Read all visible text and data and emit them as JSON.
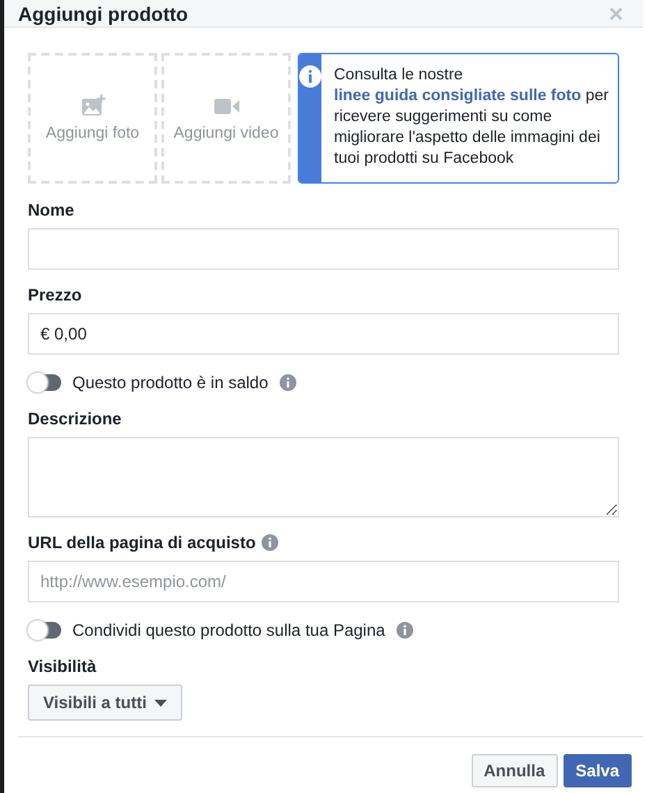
{
  "dialog": {
    "title": "Aggiungi prodotto",
    "close": "×"
  },
  "media": [
    {
      "kind": "photo",
      "label": "Aggiungi foto"
    },
    {
      "kind": "video",
      "label": "Aggiungi video"
    }
  ],
  "notice": {
    "before": "Consulta le nostre ",
    "link": "linee guida consigliate sulle foto",
    "after": " per ricevere suggerimenti su come migliorare l'aspetto delle immagini dei tuoi prodotti su Facebook"
  },
  "fields": [
    {
      "kind": "text",
      "label": "Nome",
      "info": false
    },
    {
      "kind": "text",
      "label": "Prezzo",
      "info": false,
      "value": "€ 0,00"
    },
    {
      "kind": "toggle",
      "label": "Questo prodotto è in saldo",
      "info": true,
      "on": false
    },
    {
      "kind": "textarea",
      "label": "Descrizione",
      "info": false
    },
    {
      "kind": "text",
      "label": "URL della pagina di acquisto",
      "info": true,
      "placeholder": "http://www.esempio.com/"
    },
    {
      "kind": "toggle",
      "label": "Condividi questo prodotto sulla tua Pagina",
      "info": true,
      "on": false
    },
    {
      "kind": "dropdown",
      "label": "Visibilità",
      "info": false,
      "value": "Visibili a tutti"
    }
  ],
  "buttons": [
    {
      "label": "Annulla",
      "primary": false
    },
    {
      "label": "Salva",
      "primary": true
    }
  ]
}
